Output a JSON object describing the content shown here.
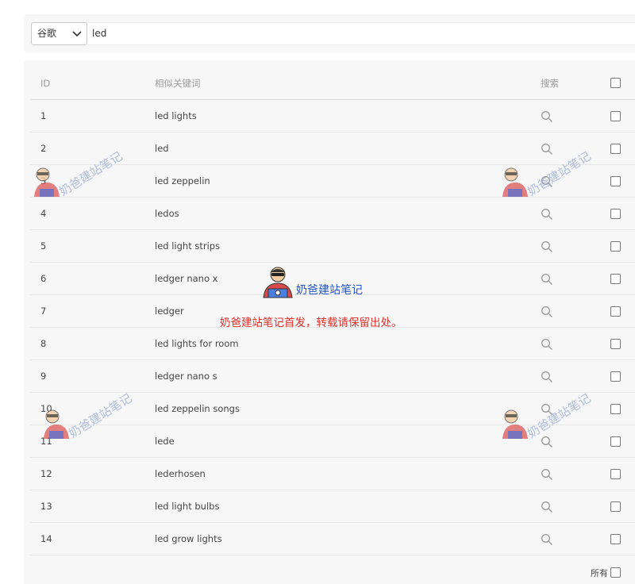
{
  "search": {
    "engine": "谷歌",
    "query": "led"
  },
  "table": {
    "headers": {
      "id": "ID",
      "keyword": "相似关键词",
      "search": "搜索"
    },
    "rows": [
      {
        "id": "1",
        "keyword": "led lights"
      },
      {
        "id": "2",
        "keyword": "led"
      },
      {
        "id": "3",
        "keyword": "led zeppelin"
      },
      {
        "id": "4",
        "keyword": "ledos"
      },
      {
        "id": "5",
        "keyword": "led light strips"
      },
      {
        "id": "6",
        "keyword": "ledger nano x"
      },
      {
        "id": "7",
        "keyword": "ledger"
      },
      {
        "id": "8",
        "keyword": "led lights for room"
      },
      {
        "id": "9",
        "keyword": "ledger nano s"
      },
      {
        "id": "10",
        "keyword": "led zeppelin songs"
      },
      {
        "id": "11",
        "keyword": "lede"
      },
      {
        "id": "12",
        "keyword": "lederhosen"
      },
      {
        "id": "13",
        "keyword": "led light bulbs"
      },
      {
        "id": "14",
        "keyword": "led grow lights"
      }
    ],
    "footer": {
      "all_label": "所有"
    }
  },
  "watermark": {
    "text": "奶爸建站笔记",
    "notice": "奶爸建站笔记首发，转载请保留出处。"
  },
  "colors": {
    "panel_bg": "#f7f7f7",
    "watermark_blue": "#2255cc",
    "watermark_red": "#e0302a"
  },
  "icons": {
    "search": "magnifier-icon",
    "dropdown": "chevron-down-icon"
  }
}
